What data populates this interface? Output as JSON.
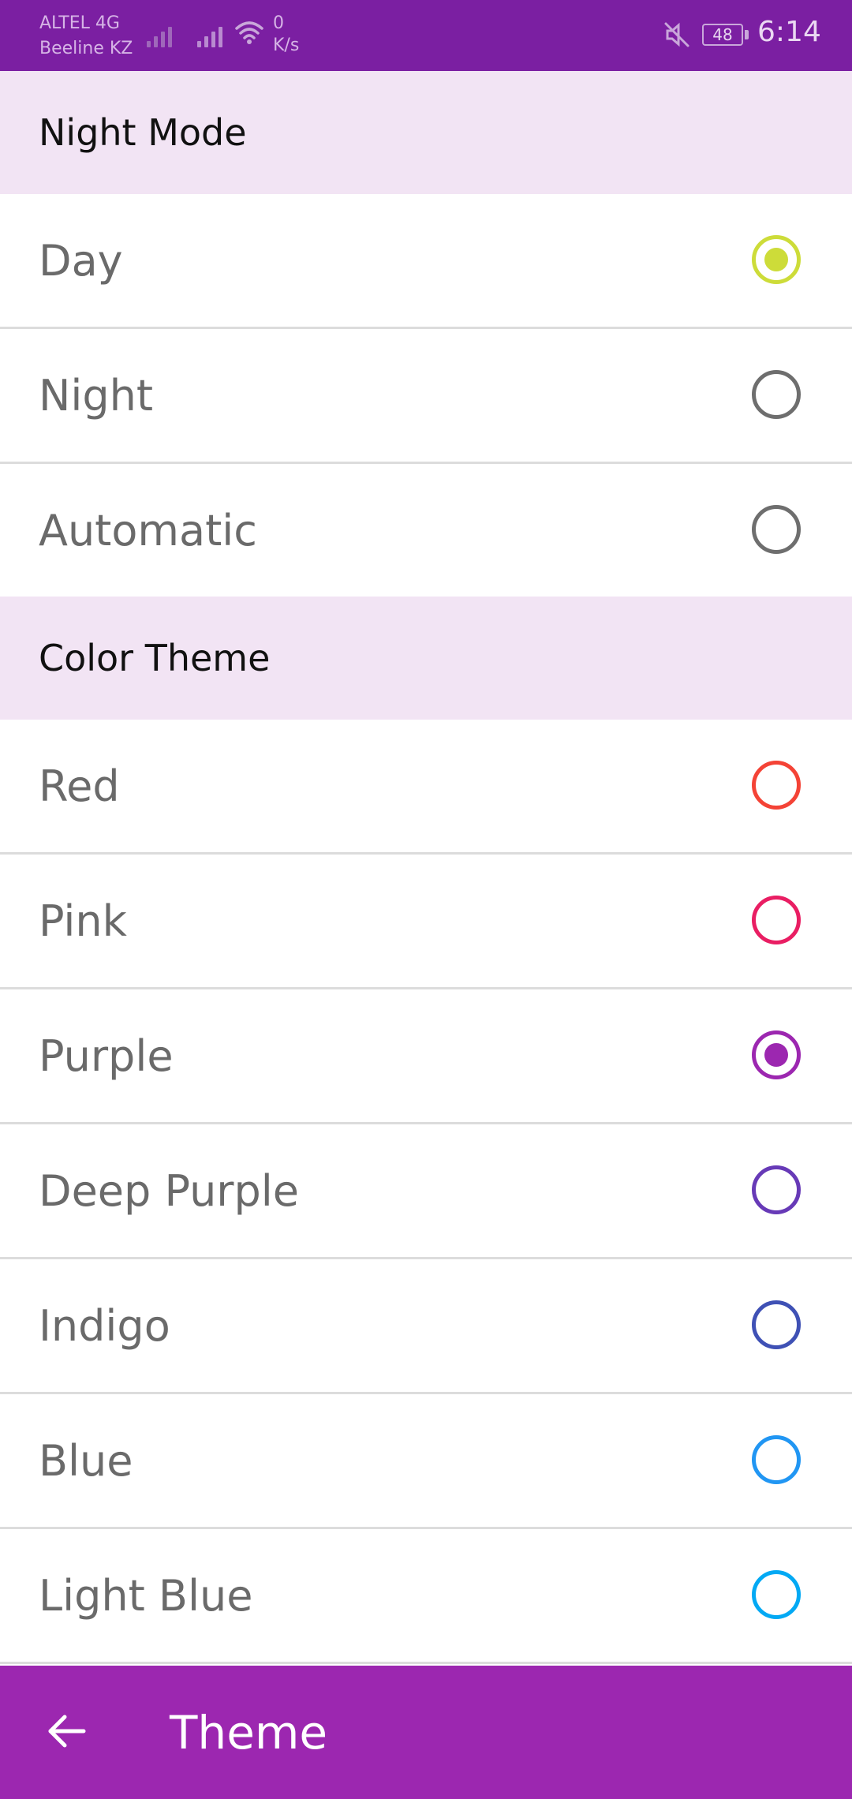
{
  "status_bar": {
    "carrier1": "ALTEL 4G",
    "carrier2": "Beeline KZ",
    "speed_value": "0",
    "speed_unit": "K/s",
    "battery": "48",
    "time": "6:14",
    "icons": [
      "signal-icon",
      "signal-icon",
      "wifi-icon",
      "mute-icon",
      "battery-icon"
    ]
  },
  "sections": [
    {
      "header": "Night Mode",
      "items": [
        {
          "label": "Day",
          "selected": true,
          "color": "#cddc39"
        },
        {
          "label": "Night",
          "selected": false,
          "color": "#6e6e6e"
        },
        {
          "label": "Automatic",
          "selected": false,
          "color": "#6e6e6e"
        }
      ]
    },
    {
      "header": "Color Theme",
      "items": [
        {
          "label": "Red",
          "selected": false,
          "color": "#f44336"
        },
        {
          "label": "Pink",
          "selected": false,
          "color": "#e91e63"
        },
        {
          "label": "Purple",
          "selected": true,
          "color": "#9c27b0"
        },
        {
          "label": "Deep Purple",
          "selected": false,
          "color": "#673ab7"
        },
        {
          "label": "Indigo",
          "selected": false,
          "color": "#3f51b5"
        },
        {
          "label": "Blue",
          "selected": false,
          "color": "#2196f3"
        },
        {
          "label": "Light Blue",
          "selected": false,
          "color": "#03a9f4"
        }
      ]
    }
  ],
  "bottom_bar": {
    "back_icon": "arrow-left-icon",
    "title": "Theme"
  },
  "colors": {
    "status_bar": "#7b1fa2",
    "accent": "#9c27b0",
    "section_header_bg": "#f2e4f4"
  }
}
